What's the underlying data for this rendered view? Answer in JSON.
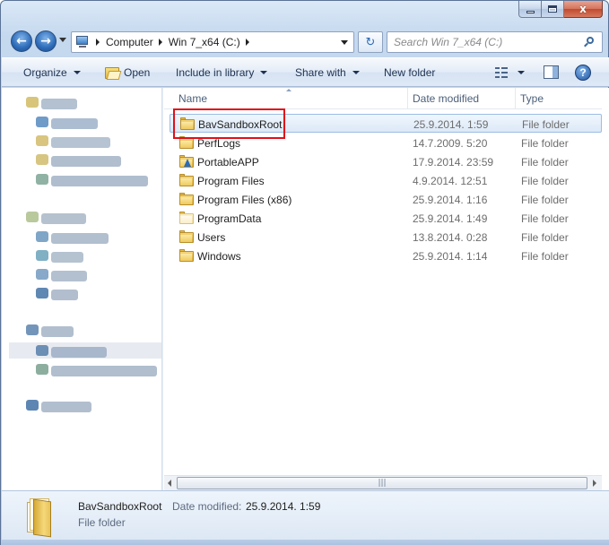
{
  "window": {
    "minimize_glyph": "",
    "close_glyph": "x"
  },
  "nav": {
    "back_glyph": "←",
    "forward_glyph": "→",
    "breadcrumbs": [
      "Computer",
      "Win 7_x64 (C:)"
    ],
    "refresh_glyph": "↻",
    "search_placeholder": "Search Win 7_x64 (C:)"
  },
  "toolbar": {
    "organize": "Organize",
    "open": "Open",
    "include_in_library": "Include in library",
    "share_with": "Share with",
    "new_folder": "New folder",
    "help": "?"
  },
  "columns": {
    "name": "Name",
    "date_modified": "Date modified",
    "type": "Type"
  },
  "files": [
    {
      "name": "BavSandboxRoot",
      "date": "25.9.2014. 1:59",
      "type": "File folder",
      "icon": "folder-icon",
      "selected": true
    },
    {
      "name": "PerfLogs",
      "date": "14.7.2009. 5:20",
      "type": "File folder",
      "icon": "folder-icon"
    },
    {
      "name": "PortableAPP",
      "date": "17.9.2014. 23:59",
      "type": "File folder",
      "icon": "folder-app-icon"
    },
    {
      "name": "Program Files",
      "date": "4.9.2014. 12:51",
      "type": "File folder",
      "icon": "folder-icon"
    },
    {
      "name": "Program Files (x86)",
      "date": "25.9.2014. 1:16",
      "type": "File folder",
      "icon": "folder-icon"
    },
    {
      "name": "ProgramData",
      "date": "25.9.2014. 1:49",
      "type": "File folder",
      "icon": "folder-hidden-icon"
    },
    {
      "name": "Users",
      "date": "13.8.2014. 0:28",
      "type": "File folder",
      "icon": "folder-icon"
    },
    {
      "name": "Windows",
      "date": "25.9.2014. 1:14",
      "type": "File folder",
      "icon": "folder-icon"
    }
  ],
  "details": {
    "name": "BavSandboxRoot",
    "date_label": "Date modified:",
    "date_value": "25.9.2014. 1:59",
    "type": "File folder"
  },
  "scrollbar": {
    "grip": "|||"
  },
  "colors": {
    "highlight_box": "#e0101a",
    "selection": "#dce9f8",
    "accent": "#2d6bb8"
  }
}
